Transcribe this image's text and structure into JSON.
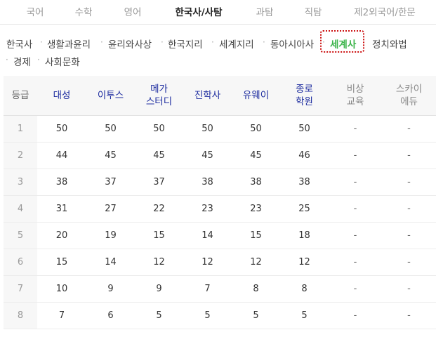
{
  "top_tabs": [
    "국어",
    "수학",
    "영어",
    "한국사/사탐",
    "과탐",
    "직탐",
    "제2외국어/한문"
  ],
  "active_top_tab": "한국사/사탐",
  "sub_nav": [
    "한국사",
    "생활과윤리",
    "윤리와사상",
    "한국지리",
    "세계지리",
    "동아시아사",
    "세계사",
    "정치와법",
    "경제",
    "사회문화"
  ],
  "active_sub": "세계사",
  "table": {
    "header_label": "등급",
    "providers": [
      {
        "name": "대성",
        "style": "blue"
      },
      {
        "name": "이투스",
        "style": "blue"
      },
      {
        "name": "메가\n스터디",
        "style": "blue"
      },
      {
        "name": "진학사",
        "style": "blue"
      },
      {
        "name": "유웨이",
        "style": "blue"
      },
      {
        "name": "종로\n학원",
        "style": "blue"
      },
      {
        "name": "비상\n교육",
        "style": "gray"
      },
      {
        "name": "스카이\n에듀",
        "style": "gray"
      }
    ],
    "rows": [
      {
        "grade": "1",
        "values": [
          "50",
          "50",
          "50",
          "50",
          "50",
          "50",
          "-",
          "-"
        ]
      },
      {
        "grade": "2",
        "values": [
          "44",
          "45",
          "45",
          "45",
          "45",
          "46",
          "-",
          "-"
        ]
      },
      {
        "grade": "3",
        "values": [
          "38",
          "37",
          "37",
          "38",
          "38",
          "38",
          "-",
          "-"
        ]
      },
      {
        "grade": "4",
        "values": [
          "31",
          "27",
          "22",
          "23",
          "23",
          "25",
          "-",
          "-"
        ]
      },
      {
        "grade": "5",
        "values": [
          "20",
          "19",
          "15",
          "14",
          "15",
          "18",
          "-",
          "-"
        ]
      },
      {
        "grade": "6",
        "values": [
          "15",
          "14",
          "12",
          "12",
          "12",
          "12",
          "-",
          "-"
        ]
      },
      {
        "grade": "7",
        "values": [
          "10",
          "9",
          "9",
          "7",
          "8",
          "8",
          "-",
          "-"
        ]
      },
      {
        "grade": "8",
        "values": [
          "7",
          "6",
          "5",
          "5",
          "5",
          "5",
          "-",
          "-"
        ]
      }
    ]
  },
  "colors": {
    "active_sub": "#3cb44b",
    "highlight_border": "#cc1111",
    "provider_blue": "#1f2ea0"
  }
}
